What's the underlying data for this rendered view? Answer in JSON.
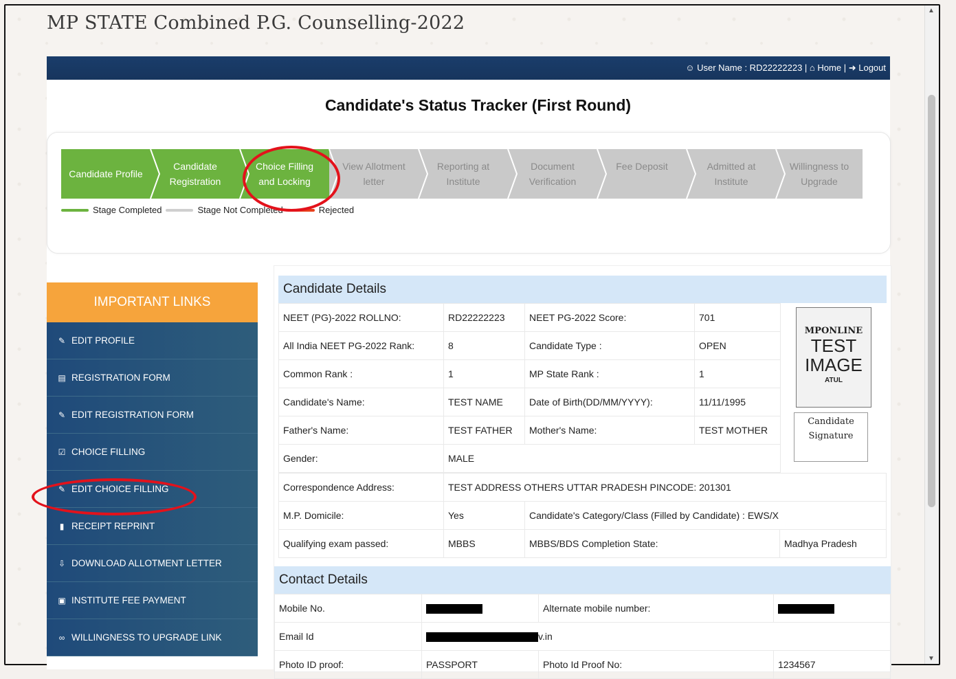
{
  "site_title": "MP STATE Combined P.G. Counselling-2022",
  "topbar": {
    "user_label": "User Name : RD22222223",
    "home": "Home",
    "logout": "Logout"
  },
  "tracker": {
    "title": "Candidate's Status Tracker (First Round)",
    "steps": [
      {
        "label": "Candidate Profile",
        "status": "completed"
      },
      {
        "label": "Candidate Registration",
        "status": "completed"
      },
      {
        "label": "Choice Filling and Locking",
        "status": "completed"
      },
      {
        "label": "View Allotment letter",
        "status": "not-completed"
      },
      {
        "label": "Reporting at Institute",
        "status": "not-completed"
      },
      {
        "label": "Document Verification",
        "status": "not-completed"
      },
      {
        "label": "Fee Deposit",
        "status": "not-completed"
      },
      {
        "label": "Admitted at Institute",
        "status": "not-completed"
      },
      {
        "label": "Willingness to Upgrade",
        "status": "not-completed"
      }
    ],
    "legend": {
      "completed": "Stage Completed",
      "not_completed": "Stage Not Completed",
      "rejected": "Rejected"
    }
  },
  "important_links": {
    "heading": "IMPORTANT LINKS",
    "items": [
      {
        "label": "EDIT PROFILE",
        "icon": "edit-icon"
      },
      {
        "label": "REGISTRATION FORM",
        "icon": "id-card-icon"
      },
      {
        "label": "EDIT REGISTRATION FORM",
        "icon": "edit-icon"
      },
      {
        "label": "CHOICE FILLING",
        "icon": "check-square-icon"
      },
      {
        "label": "EDIT CHOICE FILLING",
        "icon": "edit-icon"
      },
      {
        "label": "RECEIPT REPRINT",
        "icon": "file-icon"
      },
      {
        "label": "DOWNLOAD ALLOTMENT LETTER",
        "icon": "download-icon"
      },
      {
        "label": "INSTITUTE FEE PAYMENT",
        "icon": "credit-card-icon"
      },
      {
        "label": "WILLINGNESS TO UPGRADE LINK",
        "icon": "link-icon"
      }
    ]
  },
  "candidate_details": {
    "heading": "Candidate Details",
    "rows": [
      [
        "NEET (PG)-2022 ROLLNO:",
        "RD22222223",
        "NEET PG-2022 Score:",
        "701"
      ],
      [
        "All India NEET PG-2022 Rank:",
        "8",
        "Candidate Type :",
        "OPEN"
      ],
      [
        "Common Rank :",
        "1",
        "MP State Rank :",
        "1"
      ],
      [
        "Candidate's Name:",
        "TEST NAME",
        "Date of Birth(DD/MM/YYYY):",
        "11/11/1995"
      ],
      [
        "Father's Name:",
        "TEST FATHER",
        "Mother's Name:",
        "TEST MOTHER"
      ]
    ],
    "gender_label": "Gender:",
    "gender": "MALE",
    "address_label": "Correspondence Address:",
    "address": "TEST ADDRESS OTHERS UTTAR PRADESH PINCODE: 201301",
    "domicile_label": "M.P. Domicile:",
    "domicile": "Yes",
    "category": "Candidate's Category/Class (Filled by Candidate) : EWS/X",
    "qualifying_label": "Qualifying exam passed:",
    "qualifying": "MBBS",
    "completion_label": "MBBS/BDS Completion State:",
    "completion_state": "Madhya Pradesh",
    "photo": {
      "brand": "MPONLINE",
      "line1": "TEST",
      "line2": "IMAGE",
      "tag": "ATUL"
    },
    "signature": {
      "line1": "Candidate",
      "line2": "Signature"
    }
  },
  "contact_details": {
    "heading": "Contact Details",
    "mobile_label": "Mobile No.",
    "alt_mobile_label": "Alternate mobile number:",
    "email_label": "Email Id",
    "email_suffix": "v.in",
    "photo_id_label": "Photo ID proof:",
    "photo_id": "PASSPORT",
    "photo_id_no_label": "Photo Id Proof No:",
    "photo_id_no": "1234567"
  }
}
